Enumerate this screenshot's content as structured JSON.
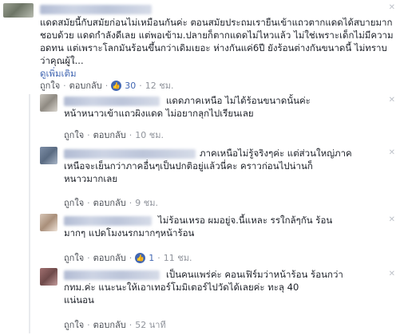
{
  "comments": [
    {
      "text": "แดดสมัยนี้กับสมัยก่อนไม่เหมือนกันค่ะ ตอนสมัยประถมเรายืนเข้าแถวตากแดดได้สบายมาก ชอบด้วย แดดกำลังดีเลย แต่พอเข้าม.ปลายก็ตากแดดไม่ไหวแล้ว ไม่ใช่เพราะเด็กไม่มีความอดทน แต่เพราะโลกมันร้อนขึ้นกว่าเดิมเยอะ ห่างกันแค่6ปี ยังร้อนต่างกันขนาดนี้ ไม่ทราบว่าคุณผู้ใ...",
      "see_more": "ดูเพิ่มเติม",
      "like": "ถูกใจ",
      "reply": "ตอบกลับ",
      "likes": "30",
      "time": "12 ชม."
    },
    {
      "text": "แดดภาคเหนือ ไม่ได้ร้อนขนาดนั้นค่ะ\nหน้าหนาวเข้าแถวผิงแดด ไม่อยากลุกไปเรียนเลย",
      "like": "ถูกใจ",
      "reply": "ตอบกลับ",
      "time": "10 ชม."
    },
    {
      "text": "ภาคเหนือไม่รู้จริงๆค่ะ แต่ส่วนใหญ่ภาค\nเหนือจะเย็นกว่าภาคอื่นๆเป็นปกติอยู่แล้วนี่คะ คราวก่อนไปน่านก็\nหนาวมากเลย",
      "like": "ถูกใจ",
      "reply": "ตอบกลับ",
      "time": "9 ชม."
    },
    {
      "text": "ไม่ร้อนเหรอ ผมอยู่จ.นี้แหละ รรใกล้ๆกัน ร้อน\nมากๆ แปดโมงนรกมากๆหน้าร้อน",
      "like": "ถูกใจ",
      "reply": "ตอบกลับ",
      "likes": "1",
      "time": "11 ชม."
    },
    {
      "text": "เป็นคนแพร่ค่ะ คอนเฟิร์มว่าหน้าร้อน ร้อนกว่า\nกทม.ค่ะ แนะนะให้เอาเทอร์โมมิเตอร์ไปวัดได้เลยค่ะ ทะลุ 40\nแน่นอน",
      "like": "ถูกใจ",
      "reply": "ตอบกลับ",
      "time": "52 นาที"
    }
  ]
}
